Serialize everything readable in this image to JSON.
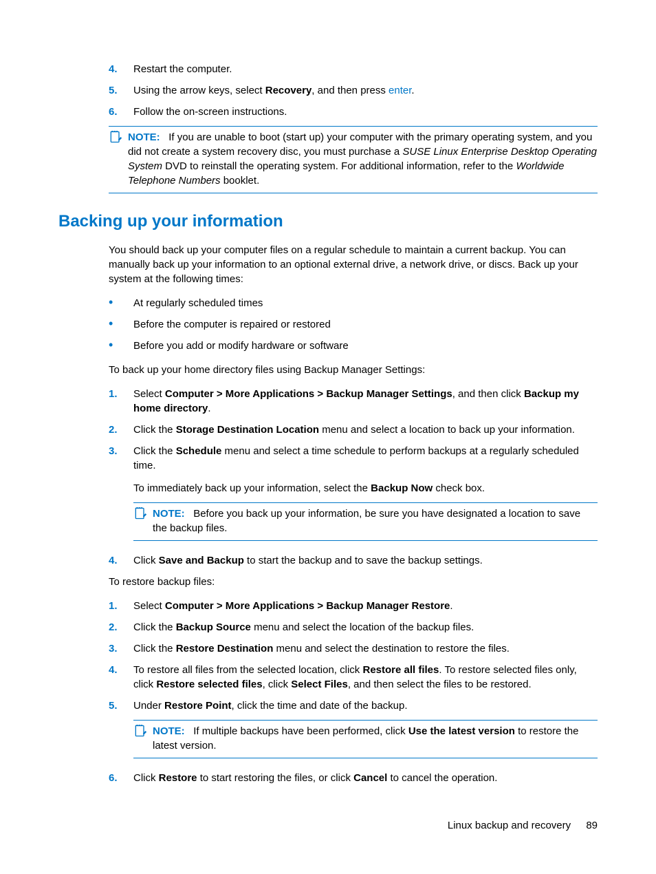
{
  "steps_top": [
    {
      "num": "4.",
      "html": "Restart the computer."
    },
    {
      "num": "5.",
      "html": "Using the arrow keys, select <span class='bold'>Recovery</span>, and then press <span class='blue'>enter</span>."
    },
    {
      "num": "6.",
      "html": "Follow the on-screen instructions."
    }
  ],
  "note1": {
    "label": "NOTE:",
    "html": "If you are unable to boot (start up) your computer with the primary operating system, and you did not create a system recovery disc, you must purchase a <span class='italic'>SUSE Linux Enterprise Desktop Operating System</span> DVD to reinstall the operating system. For additional information, refer to the <span class='italic'>Worldwide Telephone Numbers</span> booklet."
  },
  "heading": "Backing up your information",
  "intro": "You should back up your computer files on a regular schedule to maintain a current backup. You can manually back up your information to an optional external drive, a network drive, or discs. Back up your system at the following times:",
  "bullets": [
    "At regularly scheduled times",
    "Before the computer is repaired or restored",
    "Before you add or modify hardware or software"
  ],
  "backup_lead": "To back up your home directory files using Backup Manager Settings:",
  "backup_steps": [
    {
      "num": "1.",
      "html": "Select <span class='bold'>Computer &gt; More Applications &gt; Backup Manager Settings</span>, and then click <span class='bold'>Backup my home directory</span>."
    },
    {
      "num": "2.",
      "html": "Click the <span class='bold'>Storage Destination Location</span> menu and select a location to back up your information."
    },
    {
      "num": "3.",
      "html": "Click the <span class='bold'>Schedule</span> menu and select a time schedule to perform backups at a regularly scheduled time."
    }
  ],
  "backup_sub": "To immediately back up your information, select the <span class='bold'>Backup Now</span> check box.",
  "note2": {
    "label": "NOTE:",
    "html": "Before you back up your information, be sure you have designated a location to save the backup files."
  },
  "backup_step4": {
    "num": "4.",
    "html": "Click <span class='bold'>Save and Backup</span> to start the backup and to save the backup settings."
  },
  "restore_lead": "To restore backup files:",
  "restore_steps": [
    {
      "num": "1.",
      "html": "Select <span class='bold'>Computer &gt; More Applications &gt; Backup Manager Restore</span>."
    },
    {
      "num": "2.",
      "html": "Click the <span class='bold'>Backup Source</span> menu and select the location of the backup files."
    },
    {
      "num": "3.",
      "html": "Click the <span class='bold'>Restore Destination</span> menu and select the destination to restore the files."
    },
    {
      "num": "4.",
      "html": "To restore all files from the selected location, click <span class='bold'>Restore all files</span>. To restore selected files only, click <span class='bold'>Restore selected files</span>, click <span class='bold'>Select Files</span>, and then select the files to be restored."
    },
    {
      "num": "5.",
      "html": "Under <span class='bold'>Restore Point</span>, click the time and date of the backup."
    }
  ],
  "note3": {
    "label": "NOTE:",
    "html": "If multiple backups have been performed, click <span class='bold'>Use the latest version</span> to restore the latest version."
  },
  "restore_step6": {
    "num": "6.",
    "html": "Click <span class='bold'>Restore</span> to start restoring the files, or click <span class='bold'>Cancel</span> to cancel the operation."
  },
  "footer": {
    "title": "Linux backup and recovery",
    "page": "89"
  }
}
